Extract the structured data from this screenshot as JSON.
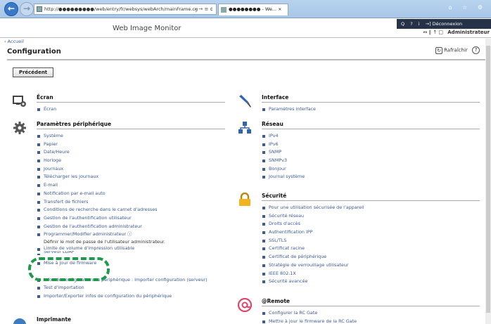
{
  "browser": {
    "address": "http://●●●●●●●●●/web/entry/fr/websys/webArch/mainFrame.cg",
    "address_tools": "⌕ → ≡ ¢",
    "tab_label": "●●●●●●●● - We... ×",
    "win_controls": "⌂ ☆ ⚙"
  },
  "app": {
    "title": "Web Image Monitor",
    "userbar": [
      "Q",
      "?",
      "i",
      "→] Déconnexion"
    ],
    "user_label": "Administrateur",
    "user_icons": "↔ ∥ ↑ □"
  },
  "breadcrumb": "‹ Accueil",
  "page": {
    "title": "Configuration",
    "refresh_label": "Rafraîchir",
    "help": "?",
    "prev_button": "Précédent"
  },
  "sections": {
    "ecran": {
      "title": "Écran",
      "items": [
        "Écran"
      ]
    },
    "params": {
      "title": "Paramètres périphérique",
      "items": [
        "Système",
        "Papier",
        "Date/Heure",
        "Horloge",
        "Journaux",
        "Télécharger les journaux",
        "E-mail",
        "Notification par e-mail auto",
        "Transfert de fichiers",
        "Conditions de recherche dans le carnet d'adresses",
        "Gestion de l'authentification utilisateur",
        "Gestion de l'authentification administrateur",
        "Programmer/Modifier administrateur ⓘ"
      ],
      "note": "Définir le mot de passe de l'utilisateur administrateur.",
      "items2": [
        "Limite de volume d'impression utilisable",
        "Serveur LDAP",
        "Mise à jour de firmware",
        "Infos de configuration du périphérique : Importer configuration (serveur)",
        "Test d'importation",
        "Importer/Exporter infos de configuration du périphérique"
      ]
    },
    "imprimante": {
      "title": "Imprimante"
    },
    "interface": {
      "title": "Interface",
      "items": [
        "Paramètres interface"
      ]
    },
    "reseau": {
      "title": "Réseau",
      "items": [
        "IPv4",
        "IPv6",
        "SNMP",
        "SNMPv3",
        "Bonjour",
        "Journal système"
      ]
    },
    "securite": {
      "title": "Sécurité",
      "items": [
        "Pour une utilisation sécurisée de l'appareil",
        "Sécurité réseau",
        "Droits d'accès",
        "Authentification IPP",
        "SSL/TLS",
        "Certificat racine",
        "Certificat de périphérique",
        "Stratégie de verrouillage utilisateur",
        "IEEE 802.1X",
        "Sécurité avancée"
      ]
    },
    "remote": {
      "title": "@Remote",
      "items": [
        "Configurer la RC Gate",
        "Mettre à jour le firmware de la RC Gate"
      ]
    }
  },
  "colors": {
    "link": "#3e5a9a",
    "highlight": "#1f9a4a",
    "userbar": "#253247"
  }
}
